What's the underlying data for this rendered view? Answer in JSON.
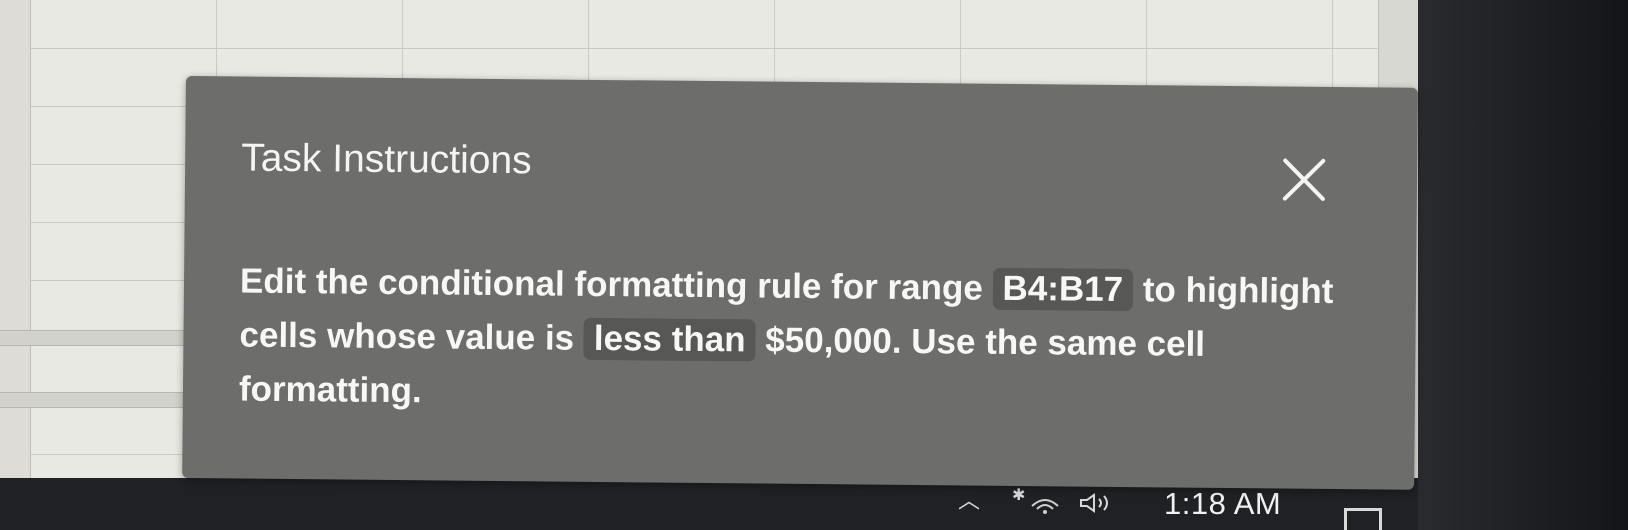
{
  "dialog": {
    "title": "Task Instructions",
    "close_icon": "close-icon",
    "instruction": {
      "part1": "Edit the conditional formatting rule for range ",
      "range": "B4:B17",
      "part2": " to highlight cells whose value is ",
      "condition": "less than",
      "part3": " $50,000. Use the same cell formatting."
    }
  },
  "taskbar": {
    "clock": "1:18 AM",
    "icons": [
      "chevron-up-icon",
      "bluetooth-icon",
      "wifi-icon",
      "volume-icon",
      "notification-icon"
    ]
  },
  "colors": {
    "dialog_bg": "#6d6d6b",
    "chip_bg": "#575756",
    "taskbar_bg": "#1f2124",
    "sheet_bg": "#e9e9e4"
  }
}
